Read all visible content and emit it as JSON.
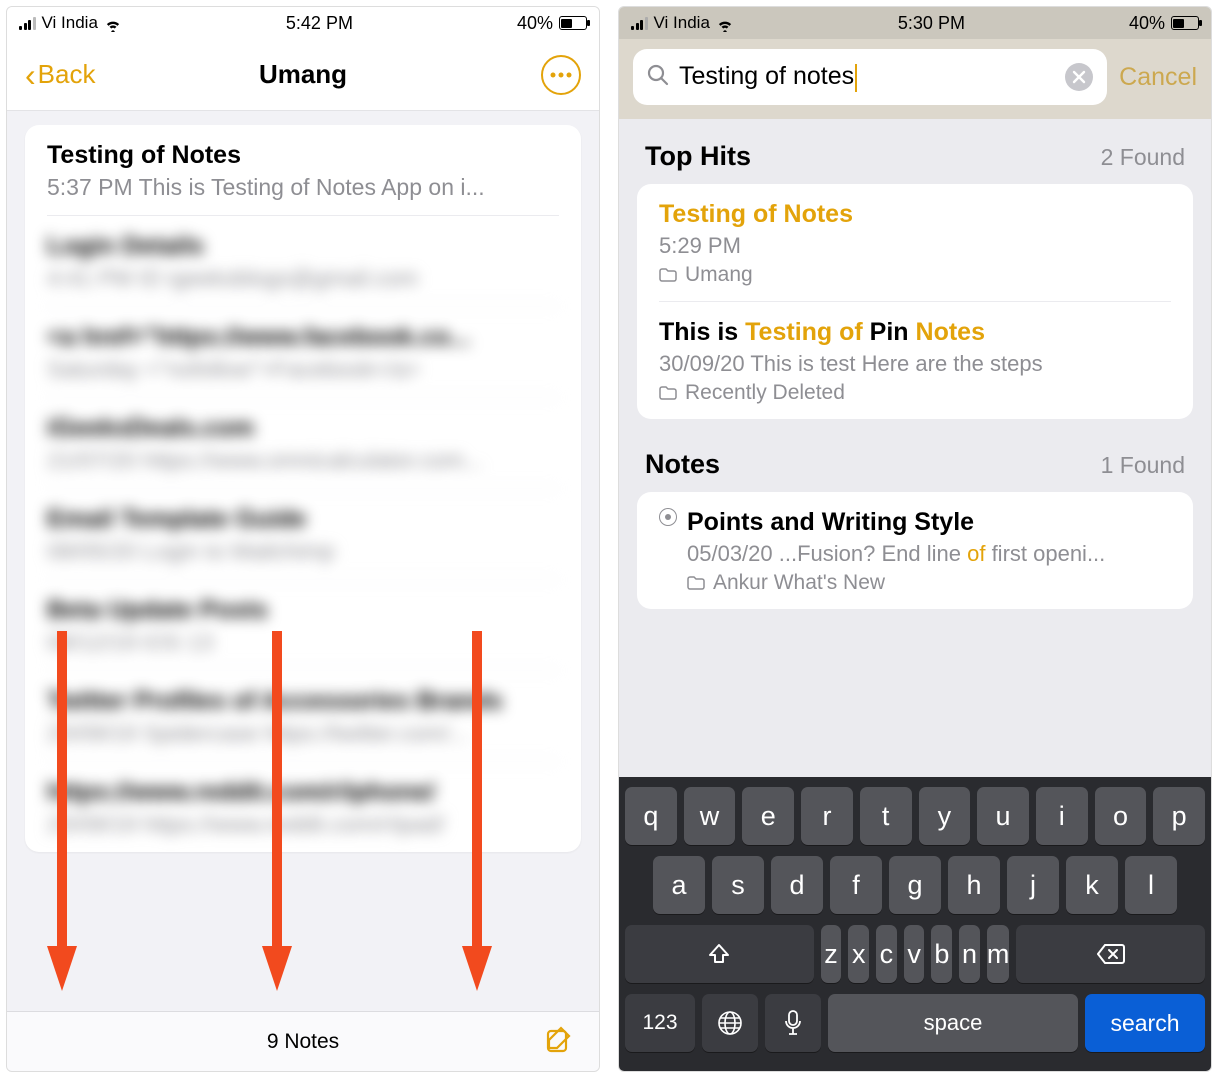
{
  "left": {
    "status": {
      "carrier": "Vi India",
      "time": "5:42 PM",
      "battery": "40%"
    },
    "nav": {
      "back": "Back",
      "title": "Umang"
    },
    "notes": [
      {
        "title": "Testing of Notes",
        "time": "5:37 PM",
        "preview": "This is Testing of Notes App on i...",
        "blurred": false
      },
      {
        "title": "Login Details",
        "time": "4:41 PM",
        "preview": "ID igeeksblogs@gmail.com",
        "blurred": true
      },
      {
        "title": "<a href=\"https://www.facebook.co...",
        "time": "Saturday",
        "preview": "<\"nofollow\">Facebook</a>",
        "blurred": true
      },
      {
        "title": "iGeeksDeals.com",
        "time": "21/07/20",
        "preview": "https://www.omnicalculator.com...",
        "blurred": true
      },
      {
        "title": "Email Template Guide",
        "time": "08/05/20",
        "preview": "Login to Mailchimp",
        "blurred": true
      },
      {
        "title": "Beta Update Posts",
        "time": "08/12/19",
        "preview": "iOS 13",
        "blurred": true
      },
      {
        "title": "Twitter Profiles of Accessories Brands",
        "time": "25/09/19",
        "preview": "Spidercase  https://twitter.com/...",
        "blurred": true
      },
      {
        "title": "https://www.reddit.com/r/iphone/",
        "time": "25/09/19",
        "preview": "https://www.reddit.com/r/ipad/",
        "blurred": true
      }
    ],
    "toolbar": {
      "count": "9 Notes"
    }
  },
  "right": {
    "status": {
      "carrier": "Vi India",
      "time": "5:30 PM",
      "battery": "40%"
    },
    "search": {
      "query": "Testing of notes",
      "cancel": "Cancel"
    },
    "sections": {
      "top_hits": {
        "label": "Top Hits",
        "count": "2 Found"
      },
      "notes": {
        "label": "Notes",
        "count": "1 Found"
      }
    },
    "results": {
      "r1": {
        "title_parts": [
          {
            "t": "Testing of Notes",
            "hl": true
          }
        ],
        "sub": "5:29 PM",
        "folder": "Umang"
      },
      "r2": {
        "title_parts": [
          {
            "t": "This is ",
            "hl": false
          },
          {
            "t": "Testing of ",
            "hl": true
          },
          {
            "t": "Pin ",
            "hl": false
          },
          {
            "t": "Notes",
            "hl": true
          }
        ],
        "sub_parts": [
          {
            "t": "30/09/20  This is test Here are the steps",
            "hl": false
          }
        ],
        "folder": "Recently Deleted"
      },
      "r3": {
        "title_parts": [
          {
            "t": "Points and Writing Style",
            "hl": false
          }
        ],
        "sub_parts": [
          {
            "t": "05/03/20  ...Fusion? End line ",
            "hl": false
          },
          {
            "t": "of",
            "hl": true
          },
          {
            "t": " first openi...",
            "hl": false
          }
        ],
        "folder": "Ankur What's New"
      }
    },
    "keyboard": {
      "row1": [
        "q",
        "w",
        "e",
        "r",
        "t",
        "y",
        "u",
        "i",
        "o",
        "p"
      ],
      "row2": [
        "a",
        "s",
        "d",
        "f",
        "g",
        "h",
        "j",
        "k",
        "l"
      ],
      "row3": [
        "z",
        "x",
        "c",
        "v",
        "b",
        "n",
        "m"
      ],
      "num": "123",
      "space": "space",
      "search": "search"
    }
  }
}
